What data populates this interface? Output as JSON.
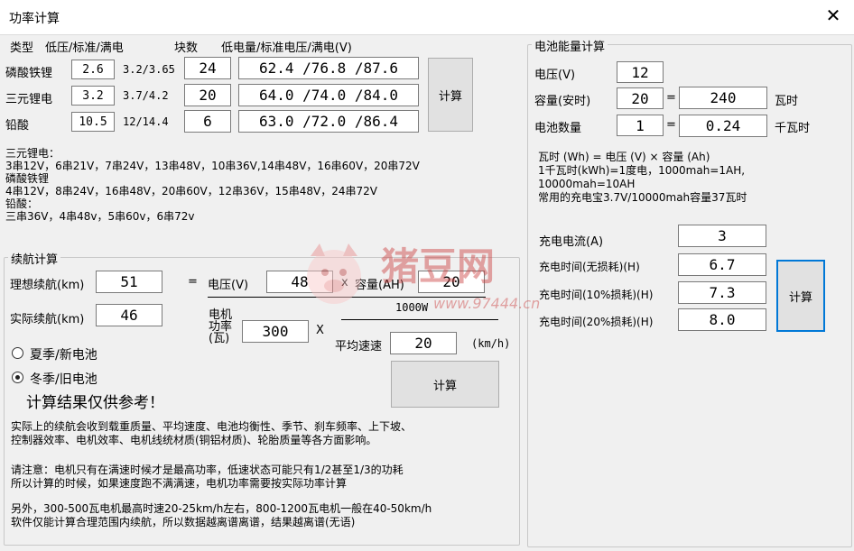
{
  "window": {
    "title": "功率计算",
    "close_glyph": "✕"
  },
  "battery_type": {
    "header": {
      "type": "类型",
      "range": "低压/标准/满电",
      "cells": "块数",
      "voltage": "低电量/标准电压/满电(V)"
    },
    "rows": [
      {
        "name": "磷酸铁锂",
        "cell_v": "2.6",
        "range": "3.2/3.65",
        "count": "24",
        "voltage": "62.4 /76.8 /87.6"
      },
      {
        "name": "三元锂电",
        "cell_v": "3.2",
        "range": "3.7/4.2",
        "count": "20",
        "voltage": "64.0 /74.0 /84.0"
      },
      {
        "name": "铅酸",
        "cell_v": "10.5",
        "range": "12/14.4",
        "count": "6",
        "voltage": "63.0 /72.0 /86.4"
      }
    ],
    "calc_label": "计算"
  },
  "notes": [
    "三元锂电：",
    "3串12V，6串21V，7串24V，13串48V，10串36V,14串48V，16串60V，20串72V",
    "磷酸铁锂",
    "4串12V，8串24V，16串48V，20串60V，12串36V，15串48V，24串72V",
    "铅酸：",
    "三串36V，4串48v，5串60v，6串72v"
  ],
  "range_calc": {
    "title": "续航计算",
    "ideal_label": "理想续航(km)",
    "ideal_value": "51",
    "actual_label": "实际续航(km)",
    "actual_value": "46",
    "equals": "=",
    "voltage_label": "电压(V)",
    "voltage_value": "48",
    "times1": "x",
    "capacity_label": "容量(AH)",
    "capacity_value": "20",
    "denominator": "1000W",
    "motor_label_1": "电机",
    "motor_label_2": "功率",
    "motor_label_3": "(瓦)",
    "motor_value": "300",
    "times2": "X",
    "speed_label": "平均速速",
    "speed_value": "20",
    "speed_unit": "(km/h)",
    "season_summer": "夏季/新电池",
    "season_winter": "冬季/旧电池",
    "selected_season": "winter",
    "reference_text": "计算结果仅供参考！",
    "calc_label": "计算",
    "paragraphs": [
      [
        "实际上的续航会收到载重质量、平均速度、电池均衡性、季节、刹车频率、上下坡、",
        "控制器效率、电机效率、电机线统材质(铜铝材质)、轮胎质量等各方面影响。"
      ],
      [
        "请注意：电机只有在满速时候才是最高功率，低速状态可能只有1/2甚至1/3的功耗",
        "所以计算的时候，如果速度跑不满满速，电机功率需要按实际功率计算"
      ],
      [
        "另外，300-500瓦电机最高时速20-25km/h左右，800-1200瓦电机一般在40-50km/h",
        "软件仅能计算合理范围内续航，所以数据越离谱离谱，结果越离谱(无语)"
      ]
    ]
  },
  "energy_calc": {
    "title": "电池能量计算",
    "voltage_label": "电压(V)",
    "voltage_value": "12",
    "capacity_label": "容量(安时)",
    "capacity_value": "20",
    "wh_value": "240",
    "wh_unit": "瓦时",
    "count_label": "电池数量",
    "count_value": "1",
    "kwh_value": "0.24",
    "kwh_unit": "千瓦时",
    "equals": "=",
    "formula_lines": [
      "瓦时 (Wh) = 电压 (V) × 容量 (Ah)",
      "1千瓦时(kWh)=1度电，1000mah=1AH,",
      "10000mah=10AH",
      "常用的充电宝3.7V/10000mah容量37瓦时"
    ],
    "current_label": "充电电流(A)",
    "current_value": "3",
    "time0_label": "充电时间(无损耗)(H)",
    "time0_value": "6.7",
    "time10_label": "充电时间(10%损耗)(H)",
    "time10_value": "7.3",
    "time20_label": "充电时间(20%损耗)(H)",
    "time20_value": "8.0",
    "calc_label": "计算"
  },
  "watermark": {
    "brand": "猪豆网",
    "url": "www.97444.cn"
  }
}
